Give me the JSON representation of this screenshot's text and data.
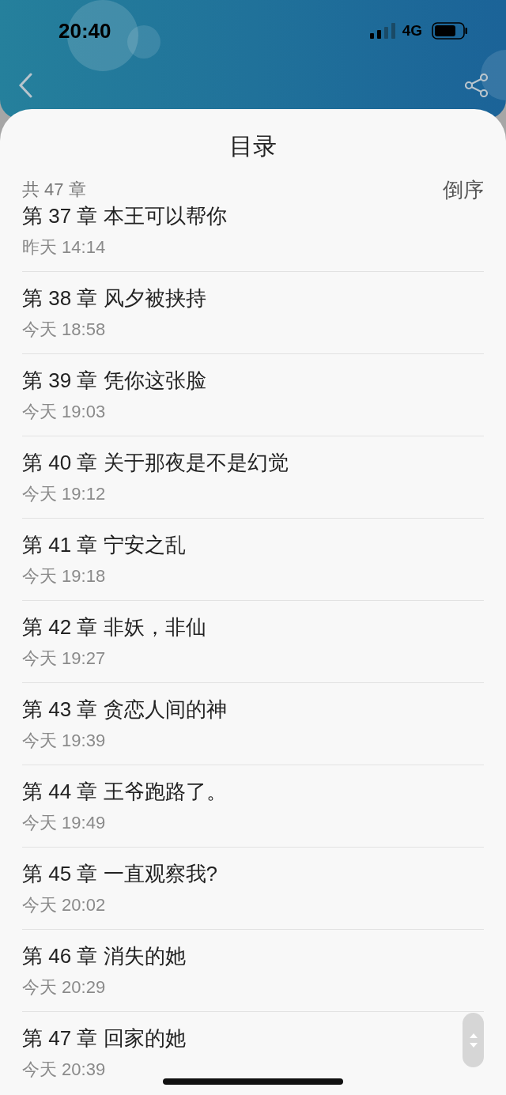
{
  "status_bar": {
    "time": "20:40",
    "network": "4G"
  },
  "sheet": {
    "title": "目录",
    "count": "共 47 章",
    "sort": "倒序"
  },
  "chapters": [
    {
      "title": "第 37 章 本王可以帮你",
      "time": "昨天 14:14"
    },
    {
      "title": "第 38 章 风夕被挟持",
      "time": "今天 18:58"
    },
    {
      "title": "第 39 章 凭你这张脸",
      "time": "今天 19:03"
    },
    {
      "title": "第 40 章 关于那夜是不是幻觉",
      "time": "今天 19:12"
    },
    {
      "title": "第 41 章 宁安之乱",
      "time": "今天 19:18"
    },
    {
      "title": "第 42 章 非妖，非仙",
      "time": "今天 19:27"
    },
    {
      "title": "第 43 章 贪恋人间的神",
      "time": "今天 19:39"
    },
    {
      "title": "第 44 章 王爷跑路了。",
      "time": "今天 19:49"
    },
    {
      "title": "第 45 章 一直观察我?",
      "time": "今天 20:02"
    },
    {
      "title": "第 46 章 消失的她",
      "time": "今天 20:29"
    },
    {
      "title": "第 47 章 回家的她",
      "time": "今天 20:39"
    }
  ]
}
